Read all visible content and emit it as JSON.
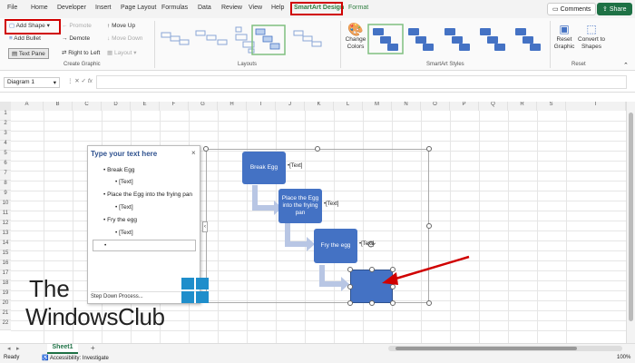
{
  "menu": {
    "tabs": [
      "File",
      "Home",
      "Developer",
      "Insert",
      "Page Layout",
      "Formulas",
      "Data",
      "Review",
      "View",
      "Help",
      "SmartArt Design",
      "Format"
    ],
    "comments": "Comments",
    "share": "Share"
  },
  "ribbon": {
    "add_shape": "Add Shape",
    "add_bullet": "Add Bullet",
    "text_pane": "Text Pane",
    "promote": "Promote",
    "demote": "Demote",
    "right_to_left": "Right to Left",
    "move_up": "Move Up",
    "move_down": "Move Down",
    "layout": "Layout",
    "create_graphic": "Create Graphic",
    "layouts": "Layouts",
    "change_colors": "Change Colors",
    "smartart_styles": "SmartArt Styles",
    "reset_graphic": "Reset Graphic",
    "convert_to_shapes": "Convert to Shapes",
    "reset": "Reset"
  },
  "formula_bar": {
    "name_box": "Diagram 1",
    "fx": "fx"
  },
  "grid": {
    "columns": [
      "A",
      "B",
      "C",
      "D",
      "E",
      "F",
      "G",
      "H",
      "I",
      "J",
      "K",
      "L",
      "M",
      "N",
      "O",
      "P",
      "Q",
      "R",
      "S",
      "T"
    ],
    "rows": [
      "1",
      "2",
      "3",
      "4",
      "5",
      "6",
      "7",
      "8",
      "9",
      "10",
      "11",
      "12",
      "13",
      "14",
      "15",
      "16",
      "17",
      "18",
      "19",
      "20",
      "21",
      "22"
    ]
  },
  "text_pane": {
    "title": "Type your text here",
    "close": "×",
    "items": [
      {
        "level": 1,
        "text": "Break Egg"
      },
      {
        "level": 2,
        "text": "[Text]"
      },
      {
        "level": 1,
        "text": "Place the Egg into the frying pan"
      },
      {
        "level": 2,
        "text": "[Text]"
      },
      {
        "level": 1,
        "text": "Fry the egg"
      },
      {
        "level": 2,
        "text": "[Text]"
      },
      {
        "level": 1,
        "text": ""
      }
    ],
    "footer": "Step Down Process..."
  },
  "smartart": {
    "shapes": [
      {
        "text": "Break Egg",
        "label": "•[Text]"
      },
      {
        "text": "Place the Egg into the frying pan",
        "label": "•[Text]"
      },
      {
        "text": "Fry the egg",
        "label": "•[Text]"
      },
      {
        "text": "",
        "label": ""
      }
    ]
  },
  "watermark": {
    "line1": "The",
    "line2": "WindowsClub"
  },
  "sheet": {
    "tab": "Sheet1",
    "add": "+"
  },
  "status": {
    "ready": "Ready",
    "accessibility": "Accessibility: Investigate",
    "zoom": "100%"
  },
  "colors": {
    "accent": "#4472c4",
    "excel_green": "#1e7145",
    "highlight": "#d00000"
  }
}
